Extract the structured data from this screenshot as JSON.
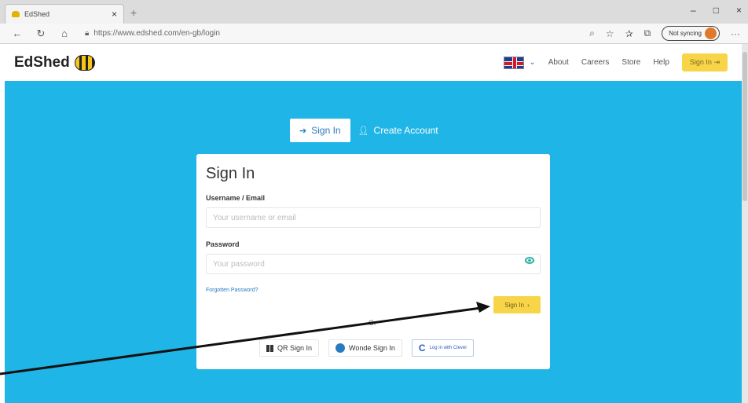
{
  "browser": {
    "tab_title": "EdShed",
    "tab_close": "×",
    "new_tab": "+",
    "window_controls": [
      "–",
      "□",
      "×"
    ],
    "url": "https://www.edshed.com/en-gb/login",
    "sync_label": "Not syncing",
    "more": "···"
  },
  "header": {
    "logo_text": "EdShed",
    "nav": [
      "About",
      "Careers",
      "Store",
      "Help"
    ],
    "signin_label": "Sign In"
  },
  "auth_tabs": {
    "signin": "Sign In",
    "create": "Create Account"
  },
  "form": {
    "title": "Sign In",
    "username_label": "Username / Email",
    "username_placeholder": "Your username or email",
    "password_label": "Password",
    "password_placeholder": "Your password",
    "forgot_label": "Forgotten Password?",
    "submit_label": "Sign In",
    "or_label": "Or",
    "qr_label": "QR Sign In",
    "wonde_label": "Wonde Sign In",
    "clever_label": "Log in with Clever"
  },
  "colors": {
    "hero": "#1fb5e6",
    "accent_yellow": "#f7d448",
    "link_blue": "#2a7abf"
  }
}
